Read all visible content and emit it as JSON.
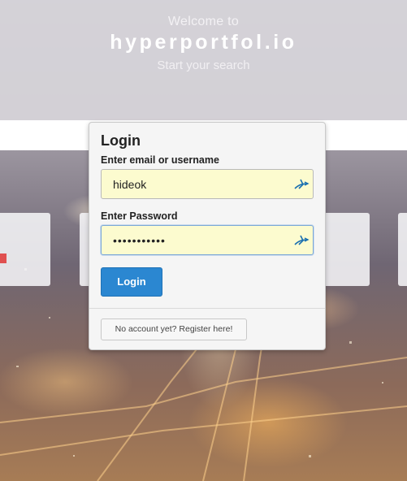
{
  "hero": {
    "welcome": "Welcome to",
    "brand": "hyperportfol.io",
    "tagline": "Start your search"
  },
  "login": {
    "title": "Login",
    "username_label": "Enter email or username",
    "username_value": "hideok",
    "password_label": "Enter Password",
    "password_value": "hyperportfo",
    "login_button": "Login",
    "register_button": "No account yet? Register here!",
    "password_manager_icon": "password-manager-icon"
  },
  "colors": {
    "accent": "#2b87d1",
    "autofill": "#fcfbcf",
    "password_icon": "#1a6fb0"
  }
}
